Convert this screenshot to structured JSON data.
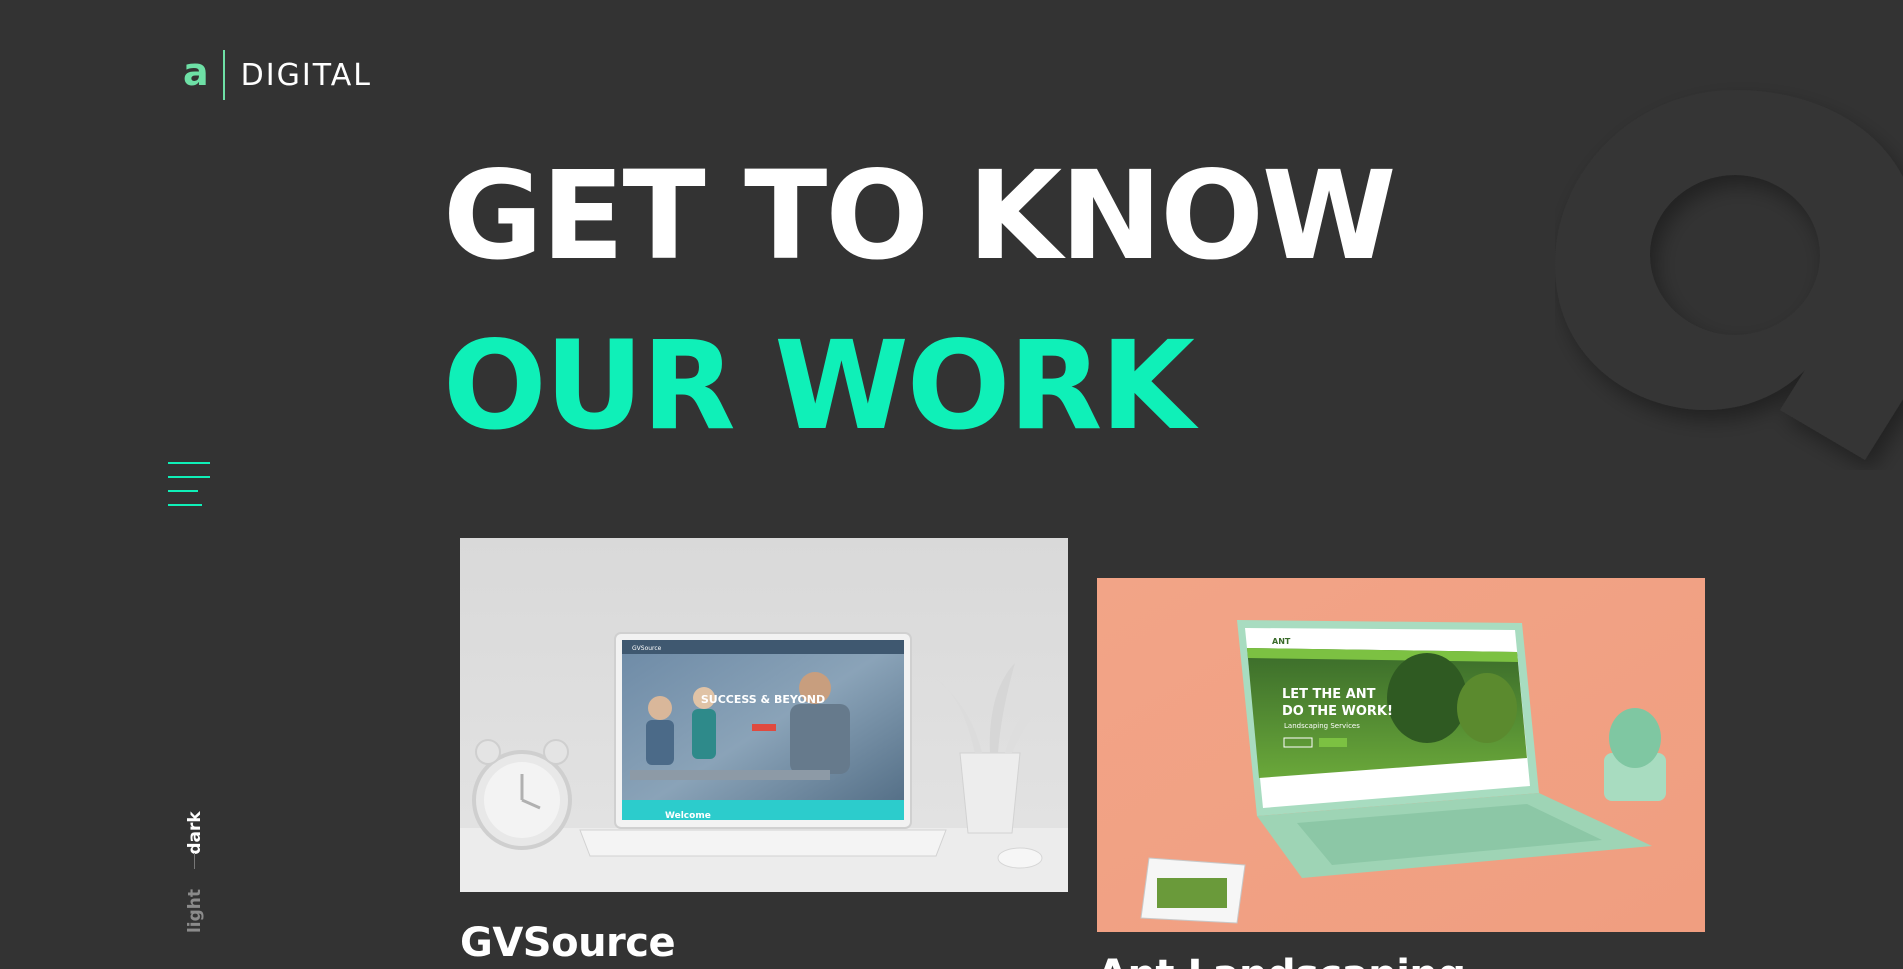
{
  "colors": {
    "background": "#333333",
    "accent": "#0ff0b8",
    "logo_accent": "#6ee0a6",
    "text": "#ffffff",
    "muted": "#8b8b8b"
  },
  "header": {
    "logo_mark": "a",
    "logo_text": "DIGITAL"
  },
  "hero": {
    "line_1": "GET TO KNOW",
    "line_2": "OUR WORK"
  },
  "menu": {
    "icon": "hamburger-menu-icon"
  },
  "theme_switch": {
    "dark_label": "dark",
    "light_label": "light",
    "active": "dark"
  },
  "portfolio": {
    "items": [
      {
        "title": "GVSource",
        "image": "laptop-mockup-gvsource",
        "screen_heading": "SUCCESS & BEYOND",
        "screen_brand": "GVSource",
        "screen_footer": "Welcome"
      },
      {
        "title": "Ant Landscaping",
        "image": "laptop-mockup-ant-landscaping",
        "screen_heading_1": "LET THE ANT",
        "screen_heading_2": "DO THE WORK!",
        "screen_subheading": "Landscaping Services",
        "screen_brand": "ANT"
      }
    ]
  }
}
